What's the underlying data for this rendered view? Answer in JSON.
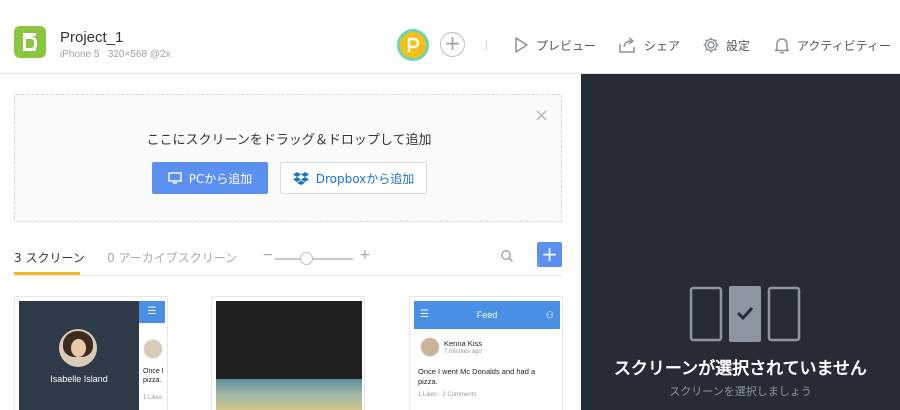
{
  "header": {
    "project_name": "Project_1",
    "device_info": "iPhone 5   320×568 @2x",
    "add_member_label": "+",
    "nav": {
      "preview": "プレビュー",
      "share": "シェア",
      "settings": "設定",
      "activity": "アクティビティー"
    }
  },
  "dropzone": {
    "text": "ここにスクリーンをドラッグ＆ドロップして追加",
    "close_label": "×",
    "pc_button": "PCから追加",
    "dropbox_button": "Dropboxから追加"
  },
  "tabs": {
    "screens": "3 スクリーン",
    "archive": "0 アーカイブスクリーン",
    "zoom_minus": "−",
    "zoom_plus": "+",
    "zoom_level": 0.4,
    "add_label": "+"
  },
  "thumbnails": {
    "screen1": {
      "name": "Isabelle Island",
      "side_text": "Once I\npizza.",
      "side_likes": "1 Likes"
    },
    "screen3": {
      "title": "Feed",
      "author": "Kenna Kiss",
      "time": "7 minutes ago",
      "post": "Once I went Mc Donalds and had a\npizza.",
      "meta": "1 Likes · 2 Comments"
    }
  },
  "right_panel": {
    "title": "スクリーンが選択されていません",
    "subtitle": "スクリーンを選択しましょう"
  },
  "colors": {
    "accent_blue": "#5b8ff0",
    "tab_underline": "#f5b820",
    "logo_green": "#8cc63f",
    "panel_dark": "#272b36"
  }
}
